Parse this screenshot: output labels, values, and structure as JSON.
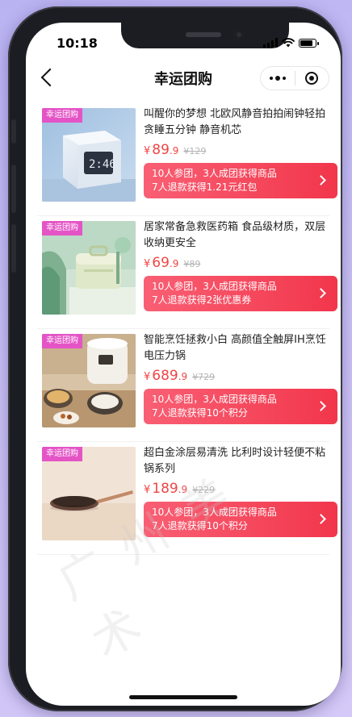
{
  "status": {
    "time": "10:18"
  },
  "nav": {
    "title": "幸运团购",
    "back_icon": "chevron-left-icon",
    "more_icon": "more-dots-icon",
    "close_icon": "target-icon"
  },
  "products": [
    {
      "badge": "幸运团购",
      "title": "叫醒你的梦想 北欧风静音拍拍闹钟轻拍贪睡五分钟 静音机芯",
      "price_currency": "¥",
      "price_main": "89",
      "price_decimal": ".9",
      "price_original": "¥129",
      "cta_line1": "10人参团，3人成团获得商品",
      "cta_line2": "7人退款获得1.21元红包",
      "image": "alarm-clock-image"
    },
    {
      "badge": "幸运团购",
      "title": "居家常备急救医药箱 食品级材质，双层收纳更安全",
      "price_currency": "¥",
      "price_main": "69",
      "price_decimal": ".9",
      "price_original": "¥89",
      "cta_line1": "10人参团，3人成团获得商品",
      "cta_line2": "7人退款获得2张优惠券",
      "image": "medicine-box-image"
    },
    {
      "badge": "幸运团购",
      "title": "智能烹饪拯救小白 高颜值全触屏IH烹饪电压力锅",
      "price_currency": "¥",
      "price_main": "689",
      "price_decimal": ".9",
      "price_original": "¥729",
      "cta_line1": "10人参团，3人成团获得商品",
      "cta_line2": "7人退款获得10个积分",
      "image": "pressure-cooker-image"
    },
    {
      "badge": "幸运团购",
      "title": "超白金涂层易清洗 比利时设计轻便不粘锅系列",
      "price_currency": "¥",
      "price_main": "189",
      "price_decimal": ".9",
      "price_original": "¥229",
      "cta_line1": "10人参团，3人成团获得商品",
      "cta_line2": "7人退款获得10个积分",
      "image": "frying-pan-image"
    }
  ],
  "watermark": "广州美术",
  "colors": {
    "accent": "#f04545",
    "badge": "#e454c6",
    "cta_start": "#f95f74",
    "cta_end": "#f2364b"
  }
}
